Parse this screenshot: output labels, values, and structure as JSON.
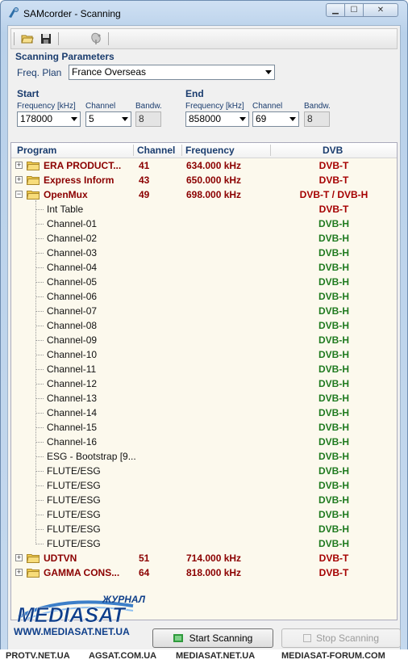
{
  "window": {
    "title": "SAMcorder - Scanning"
  },
  "toolbar": {
    "items": [
      "open-folder-icon",
      "save-icon",
      "satellite-dish-icon"
    ]
  },
  "scanning": {
    "heading": "Scanning Parameters",
    "freq_plan_label": "Freq. Plan",
    "freq_plan_value": "France Overseas",
    "start": {
      "heading": "Start",
      "frequency_label": "Frequency [kHz]",
      "frequency_value": "178000",
      "channel_label": "Channel",
      "channel_value": "5",
      "bandw_label": "Bandw.",
      "bandw_value": "8"
    },
    "end": {
      "heading": "End",
      "frequency_label": "Frequency [kHz]",
      "frequency_value": "858000",
      "channel_label": "Channel",
      "channel_value": "69",
      "bandw_label": "Bandw.",
      "bandw_value": "8"
    }
  },
  "grid": {
    "columns": [
      "Program",
      "Channel",
      "Frequency",
      "DVB"
    ],
    "rows": [
      {
        "type": "mux",
        "expander": "+",
        "program": "ERA PRODUCT...",
        "channel": "41",
        "frequency": "634.000 kHz",
        "dvb": "DVB-T"
      },
      {
        "type": "mux",
        "expander": "+",
        "program": "Express Inform",
        "channel": "43",
        "frequency": "650.000 kHz",
        "dvb": "DVB-T"
      },
      {
        "type": "mux",
        "expander": "−",
        "program": "OpenMux",
        "channel": "49",
        "frequency": "698.000 kHz",
        "dvb": "DVB-T / DVB-H"
      },
      {
        "type": "child",
        "program": "Int Table",
        "dvb": "DVB-T"
      },
      {
        "type": "child",
        "program": "Channel-01",
        "dvb": "DVB-H"
      },
      {
        "type": "child",
        "program": "Channel-02",
        "dvb": "DVB-H"
      },
      {
        "type": "child",
        "program": "Channel-03",
        "dvb": "DVB-H"
      },
      {
        "type": "child",
        "program": "Channel-04",
        "dvb": "DVB-H"
      },
      {
        "type": "child",
        "program": "Channel-05",
        "dvb": "DVB-H"
      },
      {
        "type": "child",
        "program": "Channel-06",
        "dvb": "DVB-H"
      },
      {
        "type": "child",
        "program": "Channel-07",
        "dvb": "DVB-H"
      },
      {
        "type": "child",
        "program": "Channel-08",
        "dvb": "DVB-H"
      },
      {
        "type": "child",
        "program": "Channel-09",
        "dvb": "DVB-H"
      },
      {
        "type": "child",
        "program": "Channel-10",
        "dvb": "DVB-H"
      },
      {
        "type": "child",
        "program": "Channel-11",
        "dvb": "DVB-H"
      },
      {
        "type": "child",
        "program": "Channel-12",
        "dvb": "DVB-H"
      },
      {
        "type": "child",
        "program": "Channel-13",
        "dvb": "DVB-H"
      },
      {
        "type": "child",
        "program": "Channel-14",
        "dvb": "DVB-H"
      },
      {
        "type": "child",
        "program": "Channel-15",
        "dvb": "DVB-H"
      },
      {
        "type": "child",
        "program": "Channel-16",
        "dvb": "DVB-H"
      },
      {
        "type": "child",
        "program": "ESG - Bootstrap [9...",
        "dvb": "DVB-H"
      },
      {
        "type": "child",
        "program": "FLUTE/ESG",
        "dvb": "DVB-H"
      },
      {
        "type": "child",
        "program": "FLUTE/ESG",
        "dvb": "DVB-H"
      },
      {
        "type": "child",
        "program": "FLUTE/ESG",
        "dvb": "DVB-H"
      },
      {
        "type": "child",
        "program": "FLUTE/ESG",
        "dvb": "DVB-H"
      },
      {
        "type": "child",
        "program": "FLUTE/ESG",
        "dvb": "DVB-H"
      },
      {
        "type": "child",
        "program": "FLUTE/ESG",
        "dvb": "DVB-H"
      },
      {
        "type": "mux",
        "expander": "+",
        "program": "UDTVN",
        "channel": "51",
        "frequency": "714.000 kHz",
        "dvb": "DVB-T"
      },
      {
        "type": "mux",
        "expander": "+",
        "program": "GAMMA CONS...",
        "channel": "64",
        "frequency": "818.000 kHz",
        "dvb": "DVB-T"
      }
    ]
  },
  "watermark": {
    "journal": "ЖУРНАЛ",
    "brand": "MEDIASAT",
    "url": "WWW.MEDIASAT.NET.UA"
  },
  "buttons": {
    "start_label": "Start Scanning",
    "stop_label": "Stop Scanning"
  },
  "footer": {
    "sites": [
      "PROTV.NET.UA",
      "AGSAT.COM.UA",
      "MEDIASAT.NET.UA",
      "MEDIASAT-FORUM.COM"
    ]
  },
  "colors": {
    "mux_text": "#8b0000",
    "dvb_h": "#1f7a1f",
    "header_text": "#1a3c6e",
    "grid_bg": "#fcf9ed"
  }
}
